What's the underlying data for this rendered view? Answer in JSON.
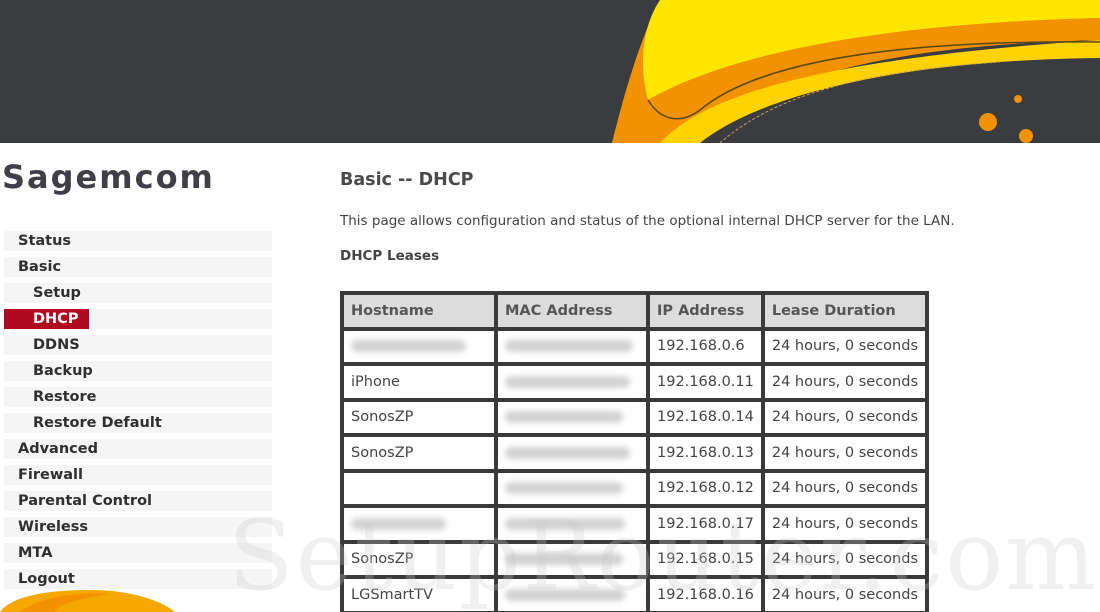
{
  "brand": {
    "logo_text": "Sagemcom",
    "accent_color": "#b10a20",
    "banner_bg": "#3b3c40",
    "banner_orange": "#f39200",
    "banner_yellow": "#ffe600"
  },
  "sidebar": {
    "items": [
      {
        "label": "Status",
        "level": 0,
        "active": false
      },
      {
        "label": "Basic",
        "level": 0,
        "active": false
      },
      {
        "label": "Setup",
        "level": 1,
        "active": false
      },
      {
        "label": "DHCP",
        "level": 1,
        "active": true
      },
      {
        "label": "DDNS",
        "level": 1,
        "active": false
      },
      {
        "label": "Backup",
        "level": 1,
        "active": false
      },
      {
        "label": "Restore",
        "level": 1,
        "active": false
      },
      {
        "label": "Restore Default",
        "level": 1,
        "active": false
      },
      {
        "label": "Advanced",
        "level": 0,
        "active": false
      },
      {
        "label": "Firewall",
        "level": 0,
        "active": false
      },
      {
        "label": "Parental Control",
        "level": 0,
        "active": false
      },
      {
        "label": "Wireless",
        "level": 0,
        "active": false
      },
      {
        "label": "MTA",
        "level": 0,
        "active": false
      },
      {
        "label": "Logout",
        "level": 0,
        "active": false
      }
    ]
  },
  "main": {
    "title": "Basic -- DHCP",
    "description": "This page allows configuration and status of the optional internal DHCP server for the LAN.",
    "leases_title": "DHCP Leases",
    "table": {
      "headers": [
        "Hostname",
        "MAC Address",
        "IP Address",
        "Lease Duration"
      ],
      "rows": [
        {
          "hostname": "",
          "hostname_blurred": true,
          "mac_blurred": true,
          "ip": "192.168.0.6",
          "lease": "24 hours, 0 seconds"
        },
        {
          "hostname": "iPhone",
          "hostname_blurred": false,
          "mac_blurred": true,
          "ip": "192.168.0.11",
          "lease": "24 hours, 0 seconds"
        },
        {
          "hostname": "SonosZP",
          "hostname_blurred": false,
          "mac_blurred": true,
          "ip": "192.168.0.14",
          "lease": "24 hours, 0 seconds"
        },
        {
          "hostname": "SonosZP",
          "hostname_blurred": false,
          "mac_blurred": true,
          "ip": "192.168.0.13",
          "lease": "24 hours, 0 seconds"
        },
        {
          "hostname": "",
          "hostname_blurred": false,
          "mac_blurred": true,
          "ip": "192.168.0.12",
          "lease": "24 hours, 0 seconds"
        },
        {
          "hostname": "",
          "hostname_blurred": true,
          "mac_blurred": true,
          "ip": "192.168.0.17",
          "lease": "24 hours, 0 seconds"
        },
        {
          "hostname": "SonosZP",
          "hostname_blurred": false,
          "mac_blurred": true,
          "ip": "192.168.0.15",
          "lease": "24 hours, 0 seconds"
        },
        {
          "hostname": "LGSmartTV",
          "hostname_blurred": false,
          "mac_blurred": true,
          "ip": "192.168.0.16",
          "lease": "24 hours, 0 seconds"
        }
      ]
    }
  },
  "watermark": "SetupRouter.com"
}
